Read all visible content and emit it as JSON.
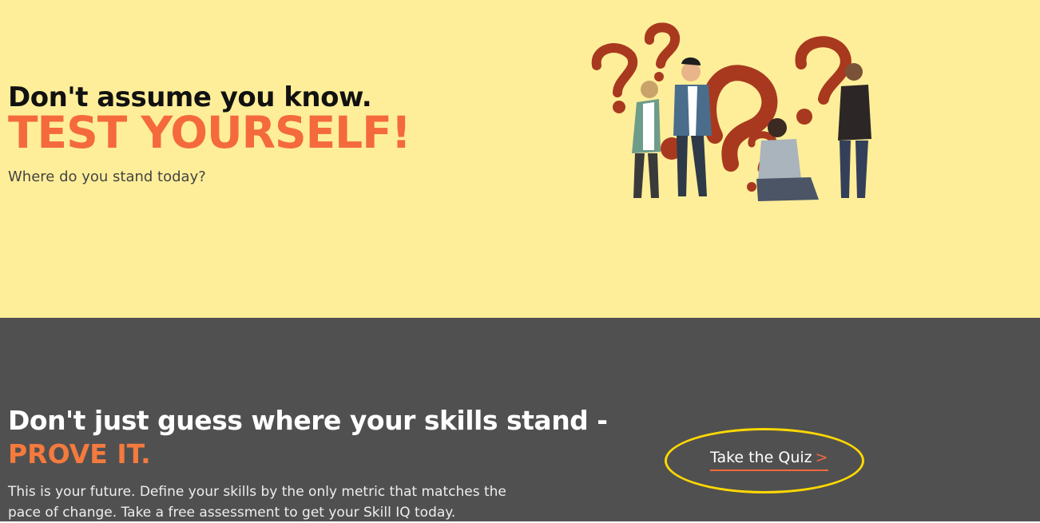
{
  "hero": {
    "line1": "Don't assume you know.",
    "line2": "TEST YOURSELF!",
    "subtitle": "Where do you stand today?"
  },
  "illustration": {
    "icon": "people-with-question-marks-illustration"
  },
  "lower": {
    "heading_line1": "Don't just guess where your skills stand -",
    "heading_line2": "PROVE IT.",
    "paragraph": "This is your future. Define your skills by the only metric that matches the pace of change. Take a free assessment to get your Skill IQ today.",
    "cta_label": "Take the Quiz",
    "cta_arrow": ">"
  },
  "colors": {
    "hero_bg": "#FFEE99",
    "accent": "#F46A3D",
    "lower_bg": "#505050",
    "highlight": "#FFD800"
  }
}
